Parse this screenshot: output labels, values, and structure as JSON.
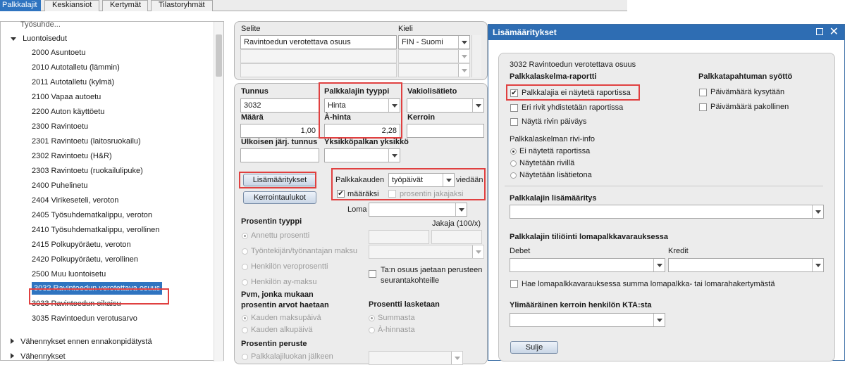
{
  "tabs": [
    "Palkkalajit",
    "Keskiansiot",
    "Kertymät",
    "Tilastoryhmät"
  ],
  "tree": {
    "cut_top_label": "Työsuhde...",
    "group_label": "Luontoisedut",
    "items": [
      "2000 Asuntoetu",
      "2010 Autotalletu (lämmin)",
      "2011 Autotalletu (kylmä)",
      "2100 Vapaa autoetu",
      "2200 Auton käyttöetu",
      "2300 Ravintoetu",
      "2301 Ravintoetu (laitosruokailu)",
      "2302 Ravintoetu (H&R)",
      "2303 Ravintoetu (ruokailulipuke)",
      "2400 Puhelinetu",
      "2404 Virikeseteli, veroton",
      "2405 Työsuhdematkalippu, veroton",
      "2410 Työsuhdematkalippu, verollinen",
      "2415 Polkupyöräetu, veroton",
      "2420 Polkupyöräetu, verollinen",
      "2500 Muu luontoisetu",
      "3032 Ravintoedun verotettava osuus",
      "3033 Ravintoedun oikaisu",
      "3035 Ravintoedun verotusarvo"
    ],
    "groups_after": [
      "Vähennykset ennen ennakonpidätystä",
      "Vähennykset"
    ]
  },
  "desc": {
    "col_selite": "Selite",
    "col_kieli": "Kieli",
    "selite_value": "Ravintoedun verotettava osuus",
    "kieli_value": "FIN - Suomi"
  },
  "form": {
    "tunnus_label": "Tunnus",
    "tunnus_value": "3032",
    "tyyppi_label": "Palkkalajin tyyppi",
    "tyyppi_value": "Hinta",
    "vakio_label": "Vakiolisätieto",
    "maara_label": "Määrä",
    "maara_value": "1,00",
    "ahinta_label": "À-hinta",
    "ahinta_value": "2,28",
    "kerroin_label": "Kerroin",
    "ulkoinen_label": "Ulkoisen järj. tunnus",
    "yksikko_label": "Yksikköpalkan yksikkö",
    "lisamaaritykset_button": "Lisämääritykset",
    "kerrointaulukot_button": "Kerrointaulukot",
    "palkkakauden_label": "Palkkakauden",
    "palkkakauden_value": "työpäivät",
    "viedaan_label": "viedään",
    "maaraksi_label": "määräksi",
    "prosentin_jakajaksi_label": "prosentin jakajaksi",
    "loma_label": "Loma",
    "prosentin_tyyppi_label": "Prosentin tyyppi",
    "jakaja_label": "Jakaja (100/x)",
    "annettu_prosentti": "Annettu prosentti",
    "tyontekijan_maksu": "Työntekijän/työnantajan maksu",
    "henkilon_veroprosentti": "Henkilön veroprosentti",
    "henkilon_ay_maksu": "Henkilön ay-maksu",
    "ta_osuus_label": "Ta:n osuus jaetaan perusteen seurantakohteille",
    "pvm_label": "Pvm, jonka mukaan prosentin arvot haetaan",
    "kauden_maksupaiva": "Kauden maksupäivä",
    "kauden_alkupaiva": "Kauden alkupäivä",
    "prosentti_lasketaan_label": "Prosentti lasketaan",
    "summasta": "Summasta",
    "a_hinnasta": "À-hinnasta",
    "prosentin_peruste_label": "Prosentin peruste",
    "palkkaluokan_jalkeen": "Palkkalajiluokan jälkeen"
  },
  "dialog": {
    "title": "Lisämääritykset",
    "header": "3032 Ravintoedun verotettava osuus",
    "raportti_label": "Palkkalaskelma-raportti",
    "cb_ei_nayteta": "Palkkalajia ei näytetä raportissa",
    "cb_eri_rivit": "Eri rivit yhdistetään raportissa",
    "cb_nayta_rivin_paivays": "Näytä rivin päiväys",
    "syotto_label": "Palkkatapahtuman syöttö",
    "cb_paivamaara_kysytaan": "Päivämäärä kysytään",
    "cb_paivamaara_pakollinen": "Päivämäärä pakollinen",
    "riviinfo_label": "Palkkalaskelman rivi-info",
    "radio_ei_nayteta": "Ei näytetä raportissa",
    "radio_naytetaan_rivilla": "Näytetään rivillä",
    "radio_naytetaan_lisatietona": "Näytetään lisätietona",
    "lisamaaritys_label": "Palkkalajin lisämääritys",
    "tilioinnti_label": "Palkkalajin tiliöinti lomapalkkavarauksessa",
    "debet_label": "Debet",
    "kredit_label": "Kredit",
    "cb_hae_lomapalkka": "Hae lomapalkkavarauksessa summa lomapalkka- tai lomarahakertymästä",
    "ylimaarainen_label": "Ylimääräinen kerroin henkilön KTA:sta",
    "close_button": "Sulje",
    "checked_mark": "✔",
    "checked_ei_nayteta": true,
    "selected_riviinfo": "Ei näytetä raportissa"
  },
  "colors": {
    "accent": "#2e6db3",
    "highlight": "#e04040",
    "selected_tree_item": "#2f74c0"
  }
}
